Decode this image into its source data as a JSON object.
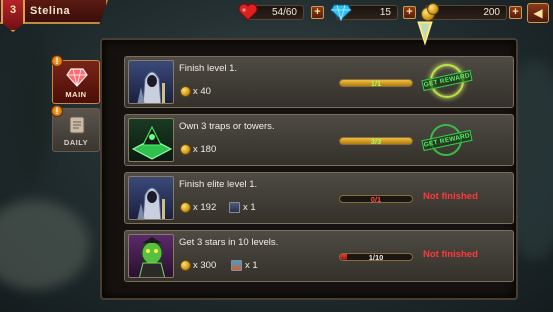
{
  "player": {
    "level": "3",
    "name": "Stelina"
  },
  "resources": {
    "lives": "54/60",
    "gems": "15",
    "gold": "200"
  },
  "plus_symbol": "+",
  "back_symbol": "◀",
  "tabs": [
    {
      "label": "Main",
      "alert": "!",
      "active": true
    },
    {
      "label": "Daily",
      "alert": "!",
      "active": false
    }
  ],
  "quests": [
    {
      "task": "Finish level 1.",
      "coins": "x 40",
      "progress": "1/1",
      "progress_fraction": 1.0,
      "status": "GET REWARD",
      "portrait": "hooded-knight",
      "item": null
    },
    {
      "task": "Own 3 traps or towers.",
      "coins": "x 180",
      "progress": "3/3",
      "progress_fraction": 1.0,
      "status": "GET REWARD",
      "portrait": "green-trap",
      "item": null
    },
    {
      "task": "Finish elite level 1.",
      "coins": "x 192",
      "progress": "0/1",
      "progress_fraction": 0.0,
      "status": "Not finished",
      "portrait": "hooded-knight",
      "item": {
        "icon": "scroll-item-icon",
        "qty": "x 1"
      }
    },
    {
      "task": "Get 3 stars in 10 levels.",
      "coins": "x 300",
      "progress": "1/10",
      "progress_fraction": 0.1,
      "status": "Not finished",
      "portrait": "green-goblin",
      "item": {
        "icon": "gem-box-item-icon",
        "qty": "x 1"
      }
    }
  ],
  "colors": {
    "complete_progress_text": "#9cff6a",
    "incomplete_progress_text": "#ff5040",
    "not_finished": "#ff3a3a",
    "stamp_green": "#3ad04a"
  }
}
